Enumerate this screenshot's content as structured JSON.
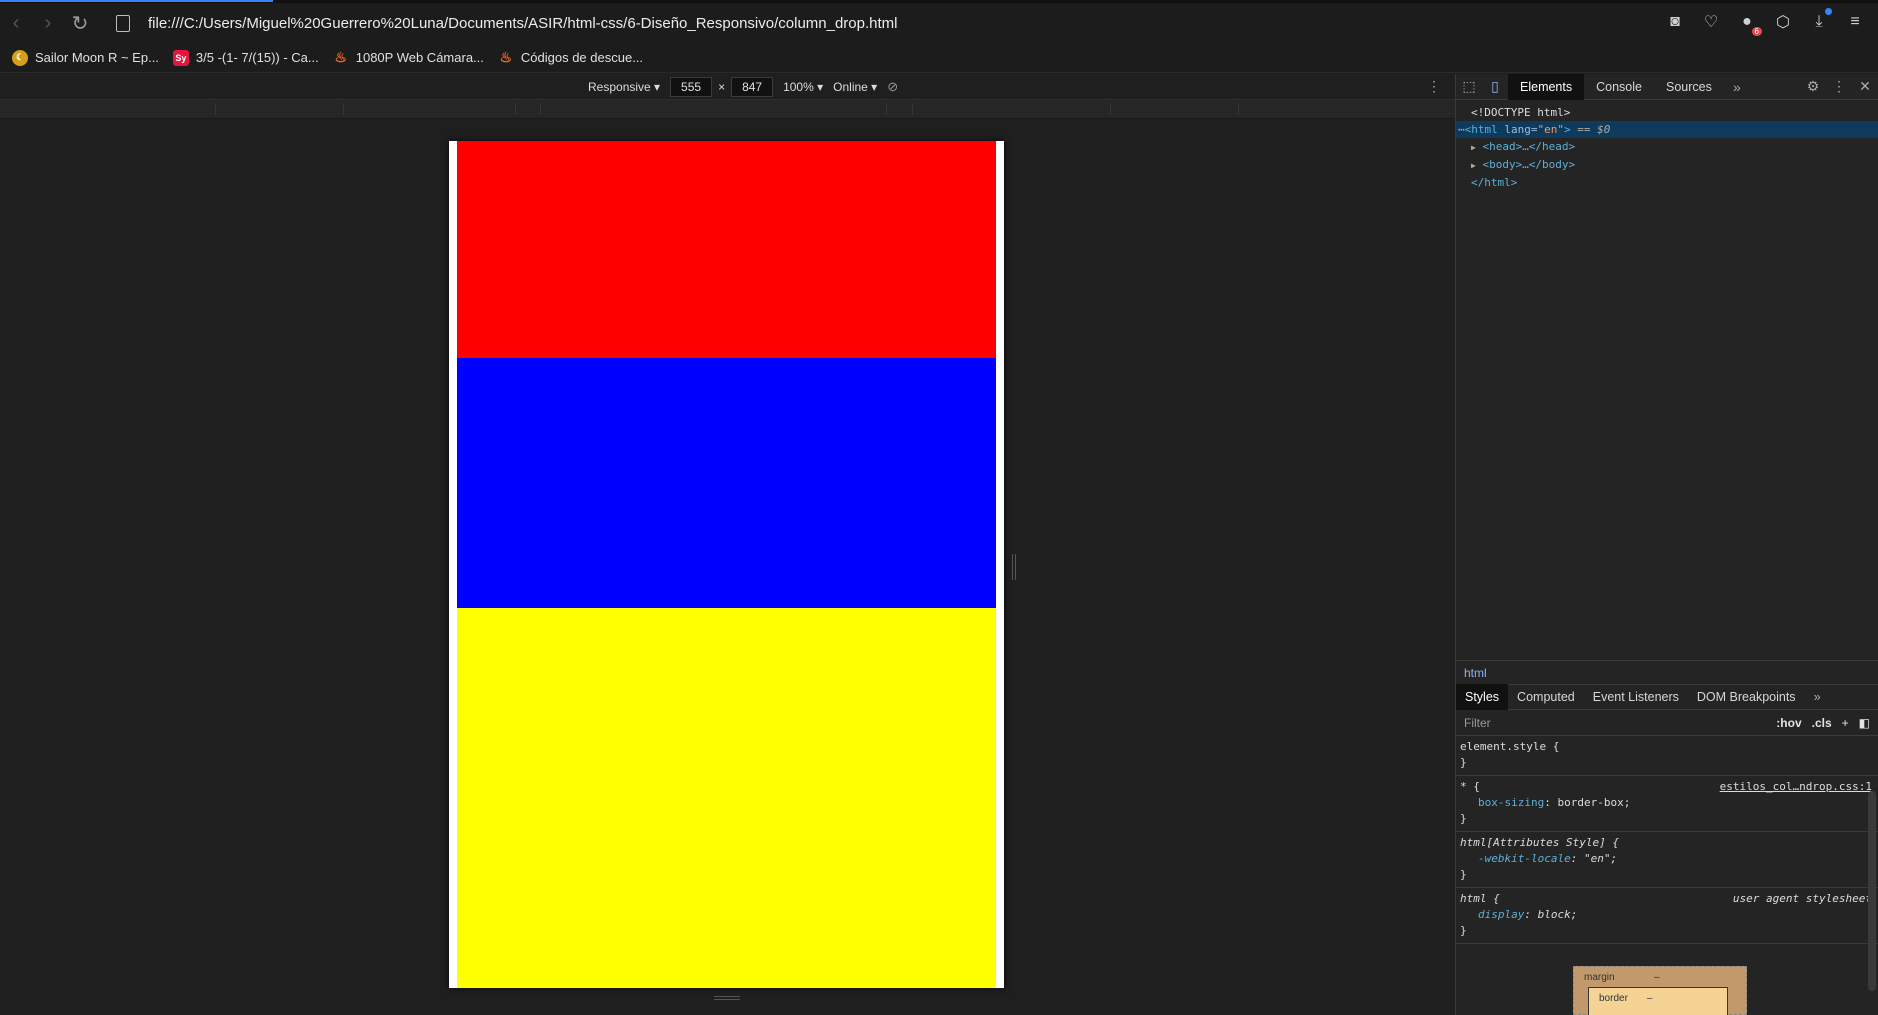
{
  "browser": {
    "url": "file:///C:/Users/Miguel%20Guerrero%20Luna/Documents/ASIR/html-css/6-Diseño_Responsivo/column_drop.html",
    "toolbar_badge": "6",
    "bookmarks": [
      {
        "label": "Sailor Moon R ~ Ep...",
        "icon": "moon-icon",
        "color": "#d4a017"
      },
      {
        "label": "3/5 -(1- 7/(15)) - Ca...",
        "icon": "sy-icon",
        "color": "#e3173e",
        "icon_text": "Sy"
      },
      {
        "label": "1080P Web Cámara...",
        "icon": "flame-icon",
        "color": "#f26522"
      },
      {
        "label": "Códigos de descue...",
        "icon": "flame-icon",
        "color": "#f26522"
      }
    ]
  },
  "device_toolbar": {
    "mode": "Responsive",
    "width": "555",
    "height": "847",
    "zoom": "100%",
    "network": "Online"
  },
  "page": {
    "blocks": [
      {
        "name": "red-block",
        "color": "#ff0000",
        "height": 217
      },
      {
        "name": "blue-block",
        "color": "#0000ff",
        "height": 250
      },
      {
        "name": "yellow-block",
        "color": "#ffff00",
        "height": 380
      }
    ]
  },
  "devtools": {
    "tabs": [
      "Elements",
      "Console",
      "Sources"
    ],
    "dom": {
      "doctype": "<!DOCTYPE html>",
      "html_open_tag": "<html",
      "lang_attr": " lang=",
      "lang_val": "\"en\"",
      "html_close_bracket": ">",
      "selected_marker": " == $0",
      "head": "<head>…</head>",
      "body": "<body>…</body>",
      "html_close": "</html>"
    },
    "breadcrumb": "html",
    "styles_tabs": [
      "Styles",
      "Computed",
      "Event Listeners",
      "DOM Breakpoints"
    ],
    "filter_placeholder": "Filter",
    "hov": ":hov",
    "cls": ".cls",
    "rules": {
      "element_style": "element.style {",
      "close": "}",
      "universal_selector": "* {",
      "universal_source": "estilos_col…ndrop.css:1",
      "box_sizing_name": "box-sizing",
      "box_sizing_value": "border-box;",
      "attr_selector": "html[Attributes Style] {",
      "locale_name": "-webkit-locale",
      "locale_value": "\"en\";",
      "html_selector": "html {",
      "ua_source": "user agent stylesheet",
      "display_name": "display",
      "display_value": "block;"
    },
    "box_model": {
      "margin_label": "margin",
      "margin_value": "–",
      "border_label": "border",
      "border_value": "–"
    }
  }
}
